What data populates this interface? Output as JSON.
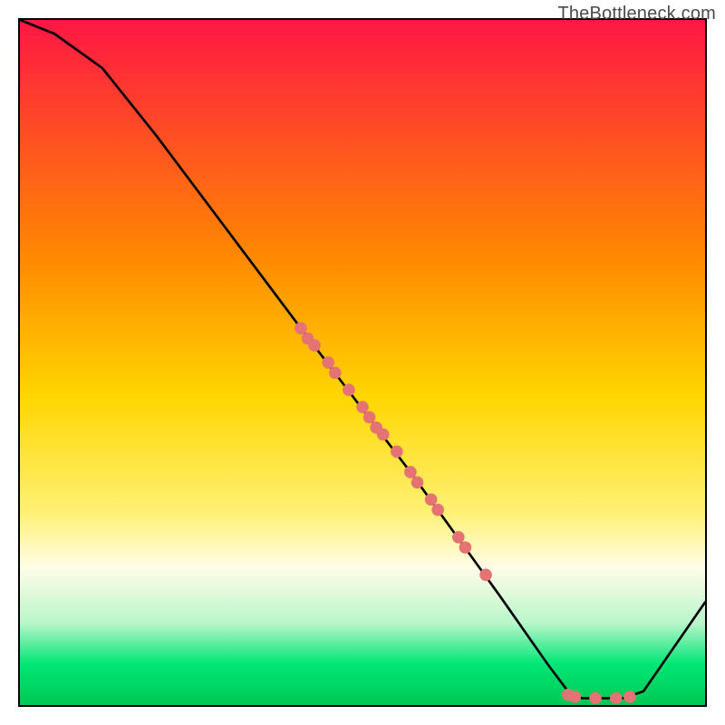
{
  "watermark": "TheBottleneck.com",
  "chart_data": {
    "type": "line",
    "title": "",
    "xlabel": "",
    "ylabel": "",
    "xlim": [
      0,
      100
    ],
    "ylim": [
      0,
      100
    ],
    "gradient_stops": [
      {
        "offset": 0,
        "color": "#ff1744"
      },
      {
        "offset": 35,
        "color": "#ff8a00"
      },
      {
        "offset": 55,
        "color": "#ffd600"
      },
      {
        "offset": 72,
        "color": "#fff176"
      },
      {
        "offset": 80,
        "color": "#fffde7"
      },
      {
        "offset": 88,
        "color": "#b9f6ca"
      },
      {
        "offset": 94,
        "color": "#00e676"
      },
      {
        "offset": 100,
        "color": "#00c853"
      }
    ],
    "curve": [
      {
        "x": 0,
        "y": 100
      },
      {
        "x": 5,
        "y": 98
      },
      {
        "x": 12,
        "y": 93
      },
      {
        "x": 20,
        "y": 83
      },
      {
        "x": 41,
        "y": 55
      },
      {
        "x": 57,
        "y": 34
      },
      {
        "x": 70,
        "y": 16
      },
      {
        "x": 77,
        "y": 6
      },
      {
        "x": 80,
        "y": 2
      },
      {
        "x": 82,
        "y": 1
      },
      {
        "x": 88,
        "y": 1
      },
      {
        "x": 91,
        "y": 2
      },
      {
        "x": 100,
        "y": 15
      }
    ],
    "marks": [
      {
        "x": 41,
        "y": 55
      },
      {
        "x": 42,
        "y": 53.5
      },
      {
        "x": 43,
        "y": 52.5
      },
      {
        "x": 45,
        "y": 50
      },
      {
        "x": 46,
        "y": 48.5
      },
      {
        "x": 48,
        "y": 46
      },
      {
        "x": 50,
        "y": 43.5
      },
      {
        "x": 51,
        "y": 42
      },
      {
        "x": 52,
        "y": 40.5
      },
      {
        "x": 53,
        "y": 39.5
      },
      {
        "x": 55,
        "y": 37
      },
      {
        "x": 57,
        "y": 34
      },
      {
        "x": 58,
        "y": 32.5
      },
      {
        "x": 60,
        "y": 30
      },
      {
        "x": 61,
        "y": 28.5
      },
      {
        "x": 64,
        "y": 24.5
      },
      {
        "x": 65,
        "y": 23
      },
      {
        "x": 68,
        "y": 19
      },
      {
        "x": 80,
        "y": 1.5
      },
      {
        "x": 81,
        "y": 1.2
      },
      {
        "x": 84,
        "y": 1
      },
      {
        "x": 87,
        "y": 1
      },
      {
        "x": 89,
        "y": 1.2
      }
    ],
    "mark_color": "#e57373",
    "curve_color": "#000000"
  }
}
